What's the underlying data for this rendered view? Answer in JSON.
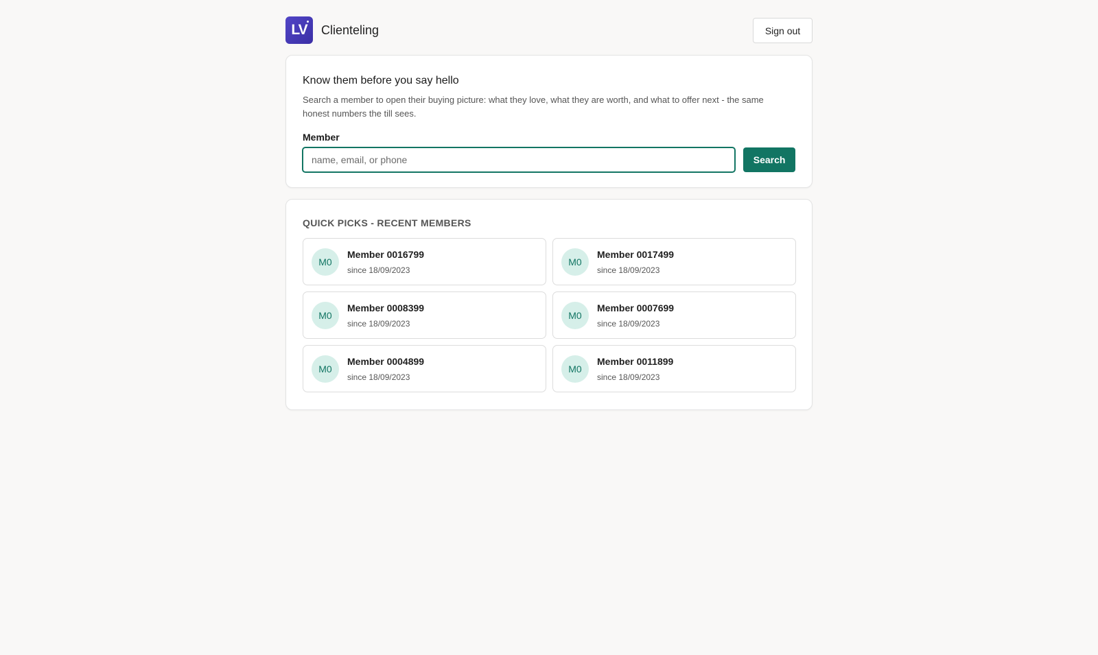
{
  "header": {
    "logo_text": "LV",
    "app_title": "Clienteling",
    "signout_label": "Sign out"
  },
  "search": {
    "title": "Know them before you say hello",
    "description": "Search a member to open their buying picture: what they love, what they are worth, and what to offer next - the same honest numbers the till sees.",
    "field_label": "Member",
    "value": "",
    "placeholder": "name, email, or phone",
    "button_label": "Search"
  },
  "quick_picks": {
    "title": "QUICK PICKS - RECENT MEMBERS",
    "members": [
      {
        "initials": "M0",
        "name": "Member 0016799",
        "since": "since 18/09/2023"
      },
      {
        "initials": "M0",
        "name": "Member 0017499",
        "since": "since 18/09/2023"
      },
      {
        "initials": "M0",
        "name": "Member 0008399",
        "since": "since 18/09/2023"
      },
      {
        "initials": "M0",
        "name": "Member 0007699",
        "since": "since 18/09/2023"
      },
      {
        "initials": "M0",
        "name": "Member 0004899",
        "since": "since 18/09/2023"
      },
      {
        "initials": "M0",
        "name": "Member 0011899",
        "since": "since 18/09/2023"
      }
    ]
  },
  "colors": {
    "accent": "#127563",
    "logo": "#4a3fbf",
    "avatar_bg": "#d6efe9",
    "page_bg": "#f9f8f7"
  }
}
